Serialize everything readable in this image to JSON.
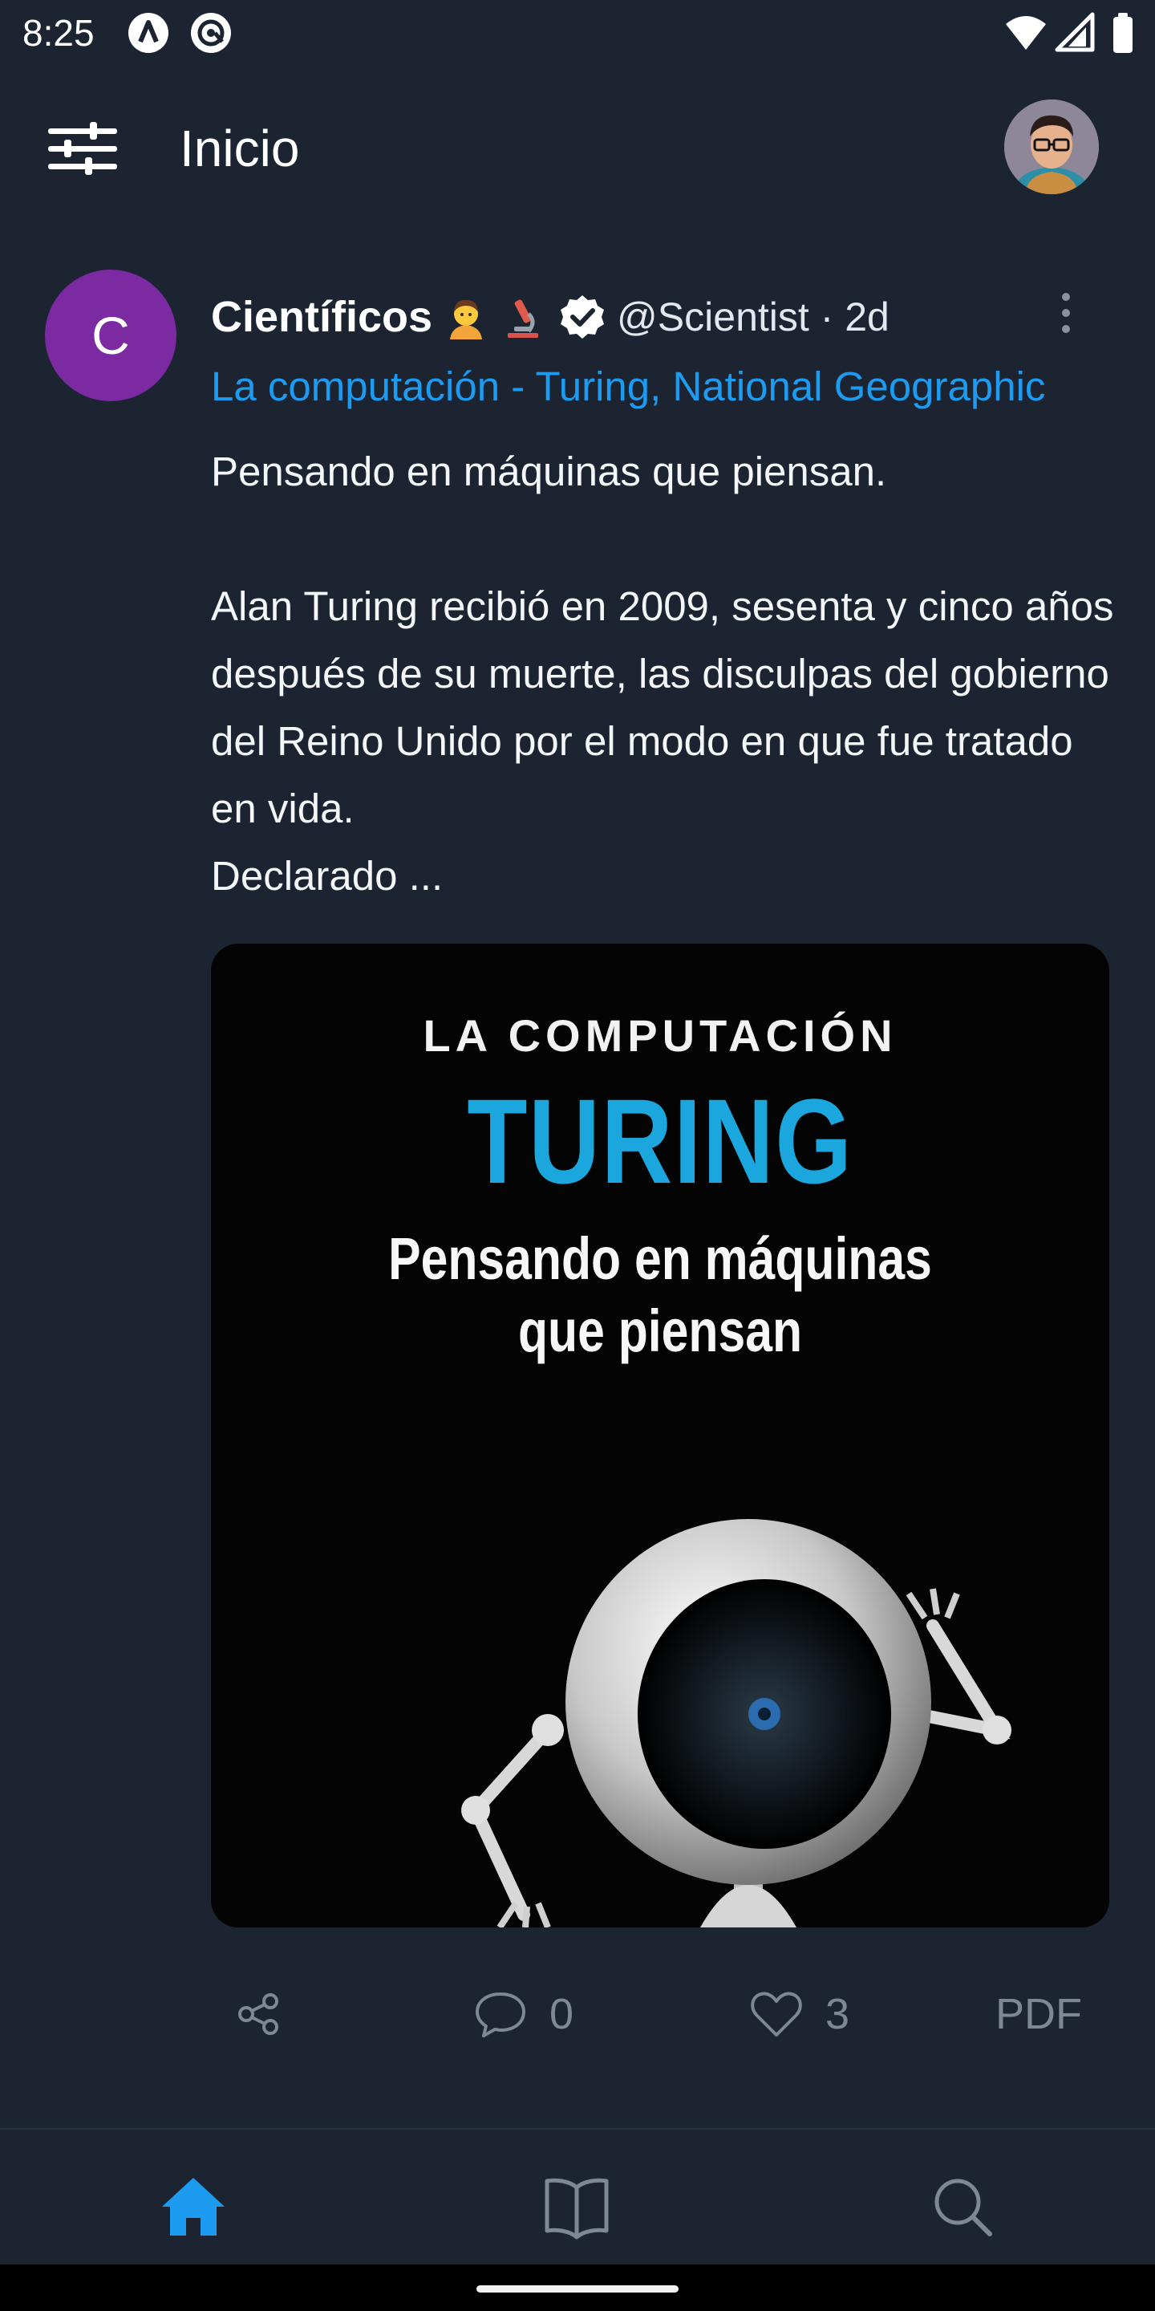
{
  "status_bar": {
    "time": "8:25",
    "left_icons": [
      "app-a-icon",
      "app-at-icon"
    ],
    "right_icons": [
      "wifi-icon",
      "signal-icon",
      "battery-icon"
    ]
  },
  "header": {
    "title": "Inicio",
    "menu_icon": "sliders-icon",
    "avatar": "profile-avatar"
  },
  "post": {
    "avatar_letter": "C",
    "avatar_color": "#7b2aa2",
    "author_name": "Científicos",
    "author_emojis": [
      "scientist-emoji",
      "microscope-emoji"
    ],
    "verified": true,
    "handle": "@Scientist · 2d",
    "link_text": "La computación - Turing, National Geographic",
    "link_color": "#1d9bf0",
    "body": "Pensando en máquinas que piensan.\n\nAlan Turing recibió en 2009, sesenta y cinco años después de su muerte, las disculpas del gobierno del Reino Unido por el modo en que fue tratado en vida.\nDeclarado ...",
    "image": {
      "overline": "LA COMPUTACIÓN",
      "title": "TURING",
      "subtitle_line1": "Pensando en máquinas",
      "subtitle_line2": "que piensan"
    },
    "actions": {
      "share_icon": "share-icon",
      "comment_count": "0",
      "like_count": "3",
      "pdf_label": "PDF"
    }
  },
  "bottom_nav": {
    "items": [
      "home-icon",
      "book-icon",
      "search-icon"
    ],
    "active": "home-icon",
    "active_color": "#1d9bf0"
  }
}
